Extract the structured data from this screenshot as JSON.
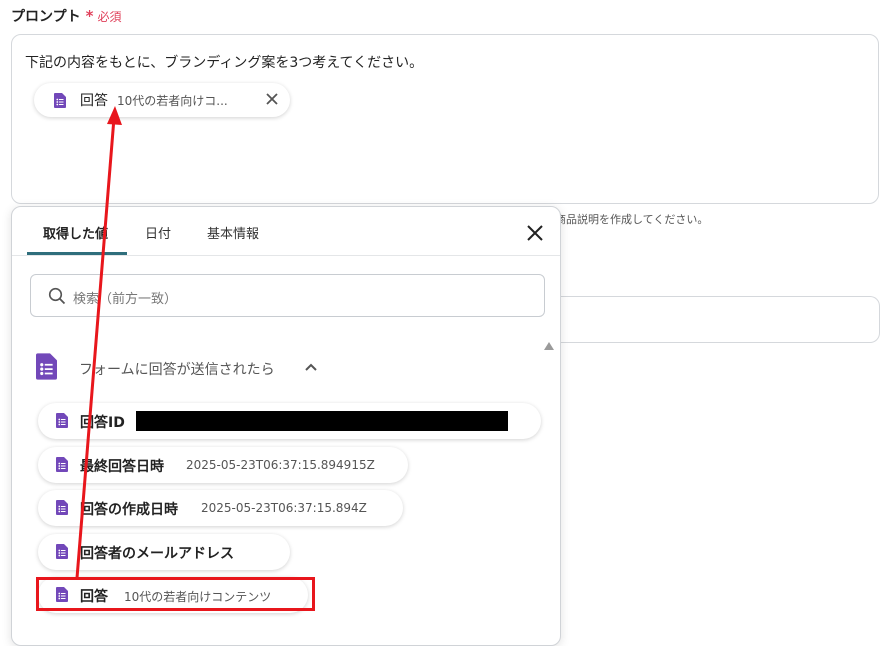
{
  "field": {
    "label": "プロンプト",
    "required_mark": "*",
    "required_label": "必須"
  },
  "prompt": {
    "text": "下記の内容をもとに、ブランディング案を3つ考えてください。",
    "variable_chip": {
      "name": "回答",
      "value": "10代の若者向けコ..."
    }
  },
  "hint": {
    "text": "商品説明を作成してください。"
  },
  "popover": {
    "tabs": [
      {
        "label": "取得した値",
        "active": true
      },
      {
        "label": "日付",
        "active": false
      },
      {
        "label": "基本情報",
        "active": false
      }
    ],
    "search": {
      "placeholder": "検索（前方一致）"
    },
    "section": {
      "title": "フォームに回答が送信されたら"
    },
    "items": [
      {
        "name": "回答ID",
        "value": ""
      },
      {
        "name": "最終回答日時",
        "value": "2025-05-23T06:37:15.894915Z"
      },
      {
        "name": "回答の作成日時",
        "value": "2025-05-23T06:37:15.894Z"
      },
      {
        "name": "回答者のメールアドレス",
        "value": ""
      },
      {
        "name": "回答",
        "value": "10代の若者向けコンテンツ"
      }
    ]
  },
  "icons": {
    "form": "google-forms-icon",
    "close": "close-icon",
    "search": "search-icon",
    "chevron": "chevron-up-icon"
  },
  "colors": {
    "accent_tab": "#2f6e7c",
    "form_icon": "#7248b9",
    "required": "#e0415b",
    "annotation": "#e8161c"
  }
}
